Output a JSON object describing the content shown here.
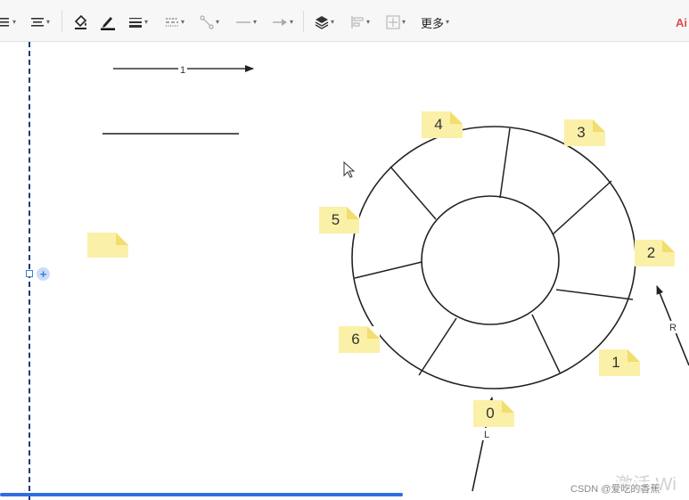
{
  "toolbar": {
    "more_label": "更多",
    "right_label": "Ai",
    "icons": [
      "list-icon",
      "align-icon",
      "fill-bucket-icon",
      "pen-color-icon",
      "line-weight-icon",
      "line-style-icon",
      "connector-icon",
      "line-end-icon",
      "arrow-style-icon",
      "layers-icon",
      "align-objects-icon",
      "distribute-icon"
    ]
  },
  "diagram": {
    "arrow_top_label": "1",
    "arrow_r_label": "R",
    "arrow_l_label": "L",
    "stickies": [
      "4",
      "3",
      "5",
      "2",
      "6",
      "1",
      "0",
      ""
    ]
  },
  "watermark": "激活 Wi",
  "credit": "CSDN @爱吃的香蕉",
  "colors": {
    "accent": "#2f6fe0",
    "sticky": "#fbf0a8",
    "line": "#333333"
  }
}
